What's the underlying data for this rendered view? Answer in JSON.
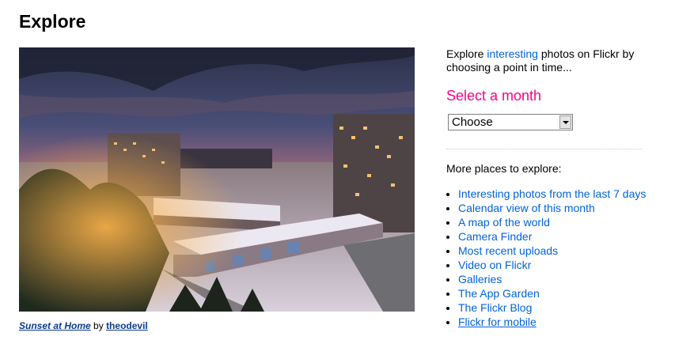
{
  "page": {
    "title": "Explore"
  },
  "photo": {
    "title": "Sunset at Home",
    "by_text": "by",
    "author": "theodevil"
  },
  "sidebar": {
    "intro_before": "Explore",
    "intro_link": "interesting",
    "intro_after": "photos on Flickr by choosing a point in time...",
    "select_heading": "Select a month",
    "select_value": "Choose",
    "more_heading": "More places to explore:",
    "links": [
      "Interesting photos from the last 7 days",
      "Calendar view of this month",
      "A map of the world",
      "Camera Finder",
      "Most recent uploads",
      "Video on Flickr",
      "Galleries",
      "The App Garden",
      "The Flickr Blog",
      "Flickr for mobile"
    ]
  },
  "colors": {
    "link": "#0063dc",
    "accent_pink": "#ff0084",
    "caption_link": "#0c3b8c"
  }
}
